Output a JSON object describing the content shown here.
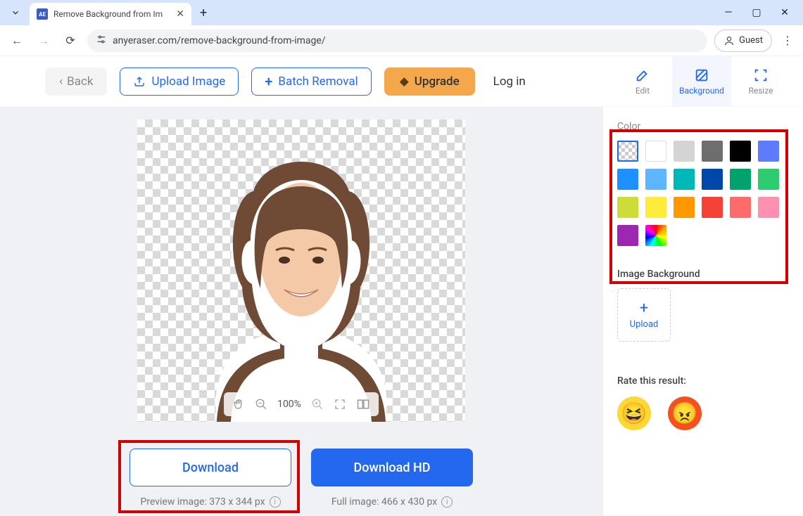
{
  "browser": {
    "tab_title": "Remove Background from Im",
    "url": "anyeraser.com/remove-background-from-image/",
    "guest_label": "Guest"
  },
  "toolbar": {
    "back": "Back",
    "upload_image": "Upload Image",
    "batch_removal": "Batch Removal",
    "upgrade": "Upgrade",
    "login": "Log in",
    "tab_edit": "Edit",
    "tab_background": "Background",
    "tab_resize": "Resize"
  },
  "canvas": {
    "zoom": "100%"
  },
  "downloads": {
    "download": "Download",
    "download_hd": "Download HD",
    "preview_label": "Preview image: 373 x 344 px",
    "full_label": "Full image: 466 x 430 px"
  },
  "sidebar": {
    "color_label": "Color",
    "swatches": [
      {
        "id": "transparent",
        "css_class": "trans",
        "selected": true
      },
      {
        "id": "white",
        "css_class": "white"
      },
      {
        "id": "lightgray",
        "color": "#d4d4d4"
      },
      {
        "id": "gray",
        "color": "#6e6e6e"
      },
      {
        "id": "black",
        "color": "#000000"
      },
      {
        "id": "periwinkle",
        "color": "#5d7bff"
      },
      {
        "id": "blue",
        "color": "#1e90ff"
      },
      {
        "id": "skyblue",
        "color": "#5eb6ff"
      },
      {
        "id": "teal",
        "color": "#00b7b7"
      },
      {
        "id": "navy",
        "color": "#0047ab"
      },
      {
        "id": "green",
        "color": "#00a36c"
      },
      {
        "id": "emerald",
        "color": "#2ecc71"
      },
      {
        "id": "lime",
        "color": "#cddc39"
      },
      {
        "id": "yellow",
        "color": "#ffeb3b"
      },
      {
        "id": "orange",
        "color": "#ff9800"
      },
      {
        "id": "red",
        "color": "#f44336"
      },
      {
        "id": "coral",
        "color": "#ff6b6b"
      },
      {
        "id": "pink",
        "color": "#ff8fb1"
      },
      {
        "id": "purple",
        "color": "#9c27b0"
      },
      {
        "id": "rainbow",
        "css_class": "rainbow"
      }
    ],
    "image_bg_label": "Image Background",
    "upload_label": "Upload",
    "rate_label": "Rate this result:"
  }
}
